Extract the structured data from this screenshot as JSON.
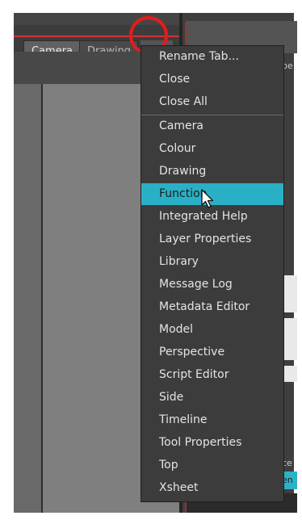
{
  "tabs": [
    {
      "label": "Camera"
    },
    {
      "label": "Drawing"
    }
  ],
  "tab_buttons": {
    "add_icon": "plus-icon",
    "close_icon": "close-icon"
  },
  "menu": {
    "items": [
      {
        "label": "Rename Tab..."
      },
      {
        "label": "Close"
      },
      {
        "label": "Close All"
      },
      {
        "label": "Camera"
      },
      {
        "label": "Colour"
      },
      {
        "label": "Drawing"
      },
      {
        "label": "Function"
      },
      {
        "label": "Integrated Help"
      },
      {
        "label": "Layer Properties"
      },
      {
        "label": "Library"
      },
      {
        "label": "Message Log"
      },
      {
        "label": "Metadata Editor"
      },
      {
        "label": "Model"
      },
      {
        "label": "Perspective"
      },
      {
        "label": "Script Editor"
      },
      {
        "label": "Side"
      },
      {
        "label": "Timeline"
      },
      {
        "label": "Tool Properties"
      },
      {
        "label": "Top"
      },
      {
        "label": "Xsheet"
      }
    ],
    "highlighted": "Function"
  },
  "right_panel_partial_text": {
    "top": "pe",
    "bottom_1": "ce",
    "bottom_2": "en"
  },
  "colors": {
    "highlight": "#2ab0c6",
    "annotation_circle": "#e41c1c"
  }
}
